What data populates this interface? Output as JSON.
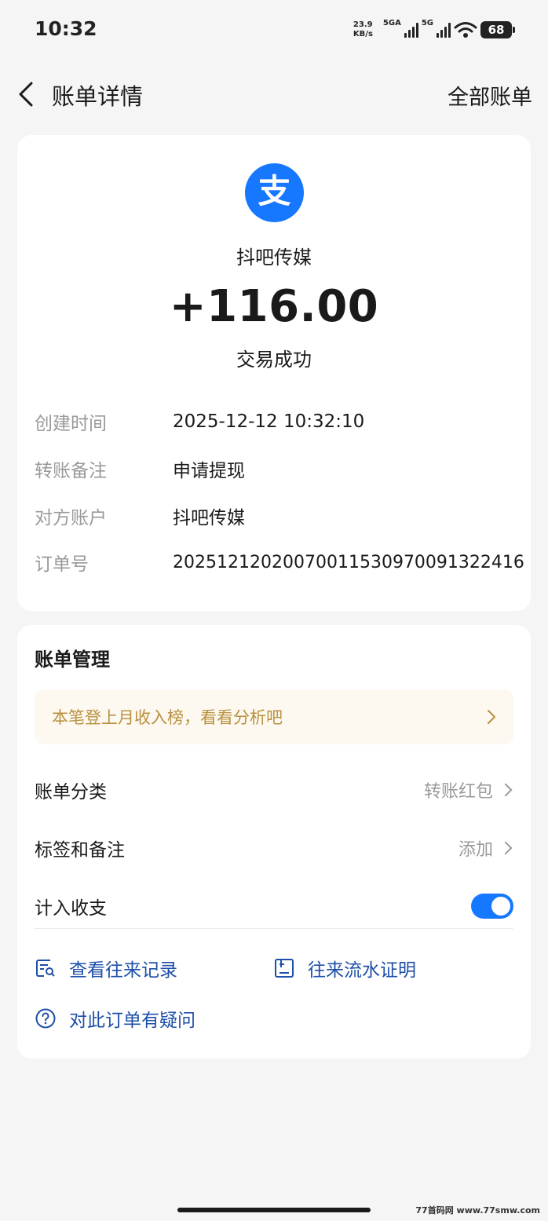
{
  "status_bar": {
    "time": "10:32",
    "net_speed_value": "23.9",
    "net_speed_unit": "KB/s",
    "sim1_label": "5GA",
    "sim2_label": "5G",
    "battery": "68"
  },
  "nav": {
    "back_icon": "chevron-left-icon",
    "title": "账单详情",
    "right_link": "全部账单"
  },
  "transaction": {
    "logo_icon": "alipay-logo",
    "logo_char": "支",
    "merchant": "抖吧传媒",
    "amount": "+116.00",
    "status": "交易成功",
    "details": [
      {
        "label": "创建时间",
        "value": "2025-12-12 10:32:10"
      },
      {
        "label": "转账备注",
        "value": "申请提现"
      },
      {
        "label": "对方账户",
        "value": "抖吧传媒"
      },
      {
        "label": "订单号",
        "value": "2025121202007001153097009132241​6"
      }
    ]
  },
  "management": {
    "title": "账单管理",
    "banner_text": "本笔登上月收入榜，看看分析吧",
    "category_label": "账单分类",
    "category_value": "转账红包",
    "tags_label": "标签和备注",
    "tags_value": "添加",
    "include_label": "计入收支",
    "include_on": true,
    "links": {
      "records": "查看往来记录",
      "proof": "往来流水证明",
      "question": "对此订单有疑问"
    }
  },
  "watermark": "77首码网 www.77smw.com",
  "colors": {
    "accent": "#1677ff",
    "banner_text": "#b8913e",
    "link_text": "#1e4fa8",
    "muted": "#9a9a9a"
  }
}
